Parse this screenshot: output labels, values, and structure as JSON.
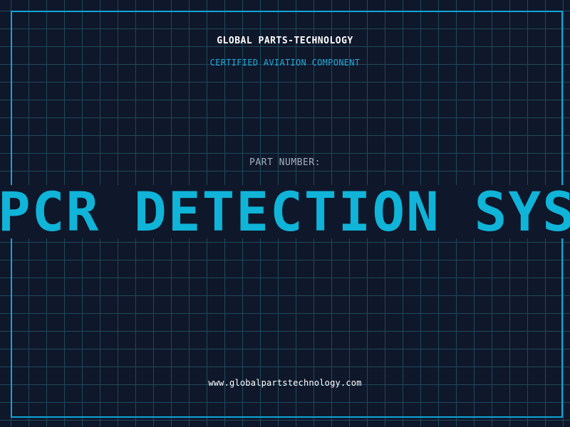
{
  "header": {
    "brand": "GLOBAL PARTS-TECHNOLOGY",
    "subtitle": "CERTIFIED AVIATION COMPONENT"
  },
  "part": {
    "label": "PART NUMBER:",
    "value": "PCR DETECTION SYST"
  },
  "footer": {
    "url": "www.globalpartstechnology.com"
  },
  "colors": {
    "background": "#0f172a",
    "grid": "#1e4a5c",
    "accent": "#0ea5d9",
    "text": "#ffffff",
    "muted": "#a3b1c2"
  }
}
